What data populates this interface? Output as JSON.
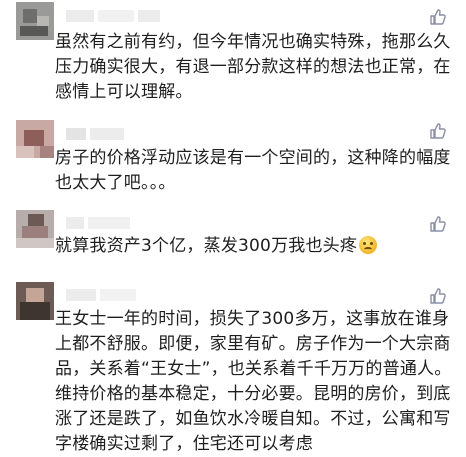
{
  "comments": [
    {
      "text": "虽然有之前有约，但今年情况也确实特殊，拖那么久压力确实很大，有退一部分款这样的想法也正常，在感情上可以理解。",
      "avatar": "blurred-avatar",
      "like_icon": "thumbs-up-icon"
    },
    {
      "text": "房子的价格浮动应该是有一个空间的，这种降的幅度也太大了吧。。。",
      "avatar": "blurred-avatar",
      "like_icon": "thumbs-up-icon"
    },
    {
      "text": "就算我资产3个亿，蒸发300万我也头疼",
      "emoji": "sweat-smile-emoji",
      "avatar": "blurred-avatar",
      "like_icon": "thumbs-up-icon"
    },
    {
      "text": "王女士一年的时间，损失了300多万，这事放在谁身上都不舒服。即便，家里有矿。房子作为一个大宗商品，关系着“王女士”，也关系着千千万万的普通人。维持价格的基本稳定，十分必要。昆明的房价，到底涨了还是跌了，如鱼饮水冷暖自知。不过，公寓和写字楼确实过剩了，住宅还可以考虑",
      "avatar": "blurred-avatar",
      "like_icon": "thumbs-up-icon"
    }
  ],
  "colors": {
    "text": "#1e1e1e",
    "icon": "#8a8fa8",
    "name_blur": "#ececec"
  }
}
